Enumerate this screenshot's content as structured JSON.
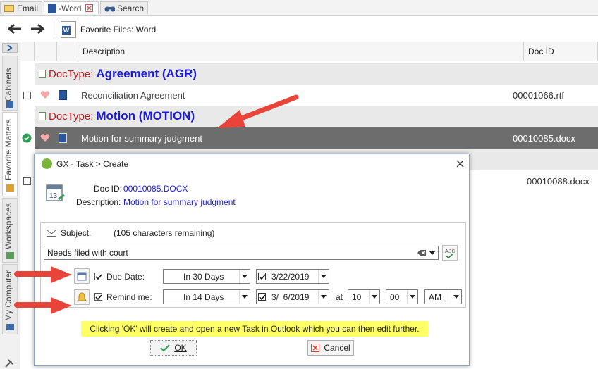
{
  "tabs": [
    {
      "label": "Email"
    },
    {
      "label": "-Word"
    },
    {
      "label": "Search"
    }
  ],
  "toolbar": {
    "title": "Favorite Files: Word"
  },
  "side_tabs": [
    "Cabinets",
    "Favorite Matters",
    "Workspaces",
    "My Computer"
  ],
  "grid": {
    "columns": [
      "Description",
      "Doc ID"
    ],
    "groups": [
      {
        "prefix": "DocType:",
        "name": "Agreement  (AGR)"
      },
      {
        "prefix": "DocType:",
        "name": "Motion  (MOTION)"
      }
    ],
    "rows": [
      {
        "description": "Reconciliation Agreement",
        "doc_id": "00001066.rtf"
      },
      {
        "description": "Motion for summary judgment",
        "doc_id": "00010085.docx"
      },
      {
        "description": "",
        "doc_id": "00010088.docx"
      }
    ]
  },
  "dialog": {
    "title": "GX - Task > Create",
    "doc_id_label": "Doc ID:",
    "doc_id": "00010085.DOCX",
    "description_label": "Description:",
    "description": "Motion for summary judgment",
    "subject_label": "Subject:",
    "chars_remaining": "(105 characters remaining)",
    "subject_value": "Needs filed with court",
    "due_label": "Due Date:",
    "due_option": "In 30 Days",
    "due_date": "3/22/2019",
    "remind_label": "Remind me:",
    "remind_option": "In 14 Days",
    "remind_date": "3/  6/2019",
    "at_label": "at",
    "hour": "10",
    "minute": "00",
    "ampm": "AM",
    "notice": "Clicking 'OK' will create and open a new Task in Outlook which you can then edit further.",
    "ok_label": "OK",
    "cancel_label": "Cancel"
  },
  "colors": {
    "accent_blue": "#1a1adb",
    "doctype_red": "#b02020",
    "selected_row": "#6d6d6d",
    "notice_yellow": "#ffff66",
    "arrow_red": "#e8443a"
  }
}
